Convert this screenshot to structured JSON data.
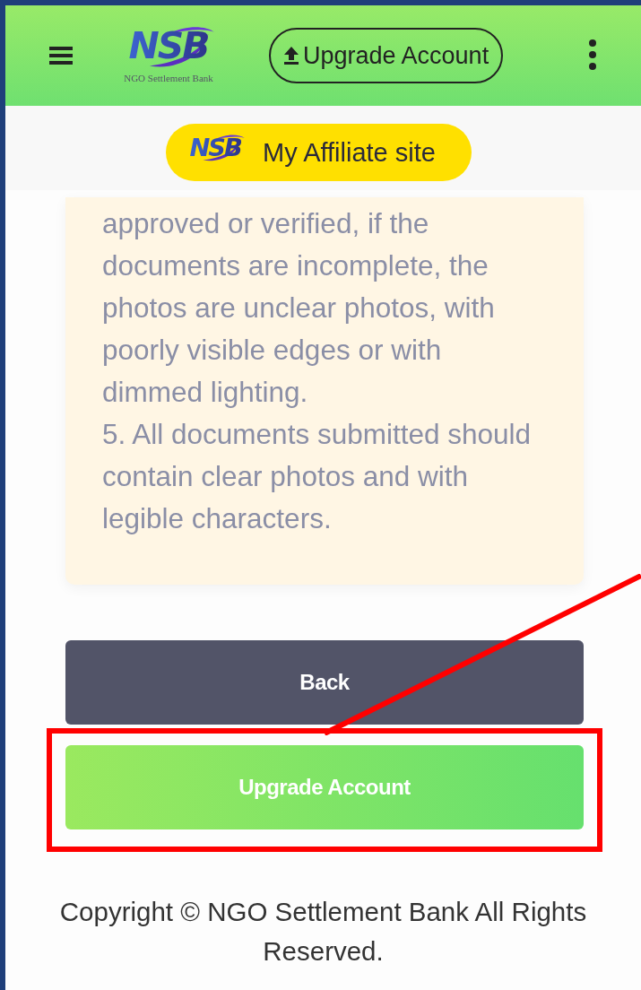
{
  "header": {
    "logo": "NSB",
    "logo_tagline": "NGO Settlement Bank",
    "upgrade_button": "Upgrade Account"
  },
  "affiliate_link": {
    "logo": "NSB",
    "label": "My Affiliate site"
  },
  "notice": {
    "paragraphs": [
      "approved or verified, if the documents are incomplete, the photos are unclear photos, with poorly visible edges or with dimmed lighting.",
      "5. All documents submitted should contain clear photos and with legible characters."
    ]
  },
  "buttons": [
    {
      "kind": "secondary",
      "label": "Back"
    },
    {
      "kind": "primary",
      "label": "Upgrade Account"
    }
  ],
  "footer": "Copyright © NGO Settlement Bank All Rights Reserved."
}
